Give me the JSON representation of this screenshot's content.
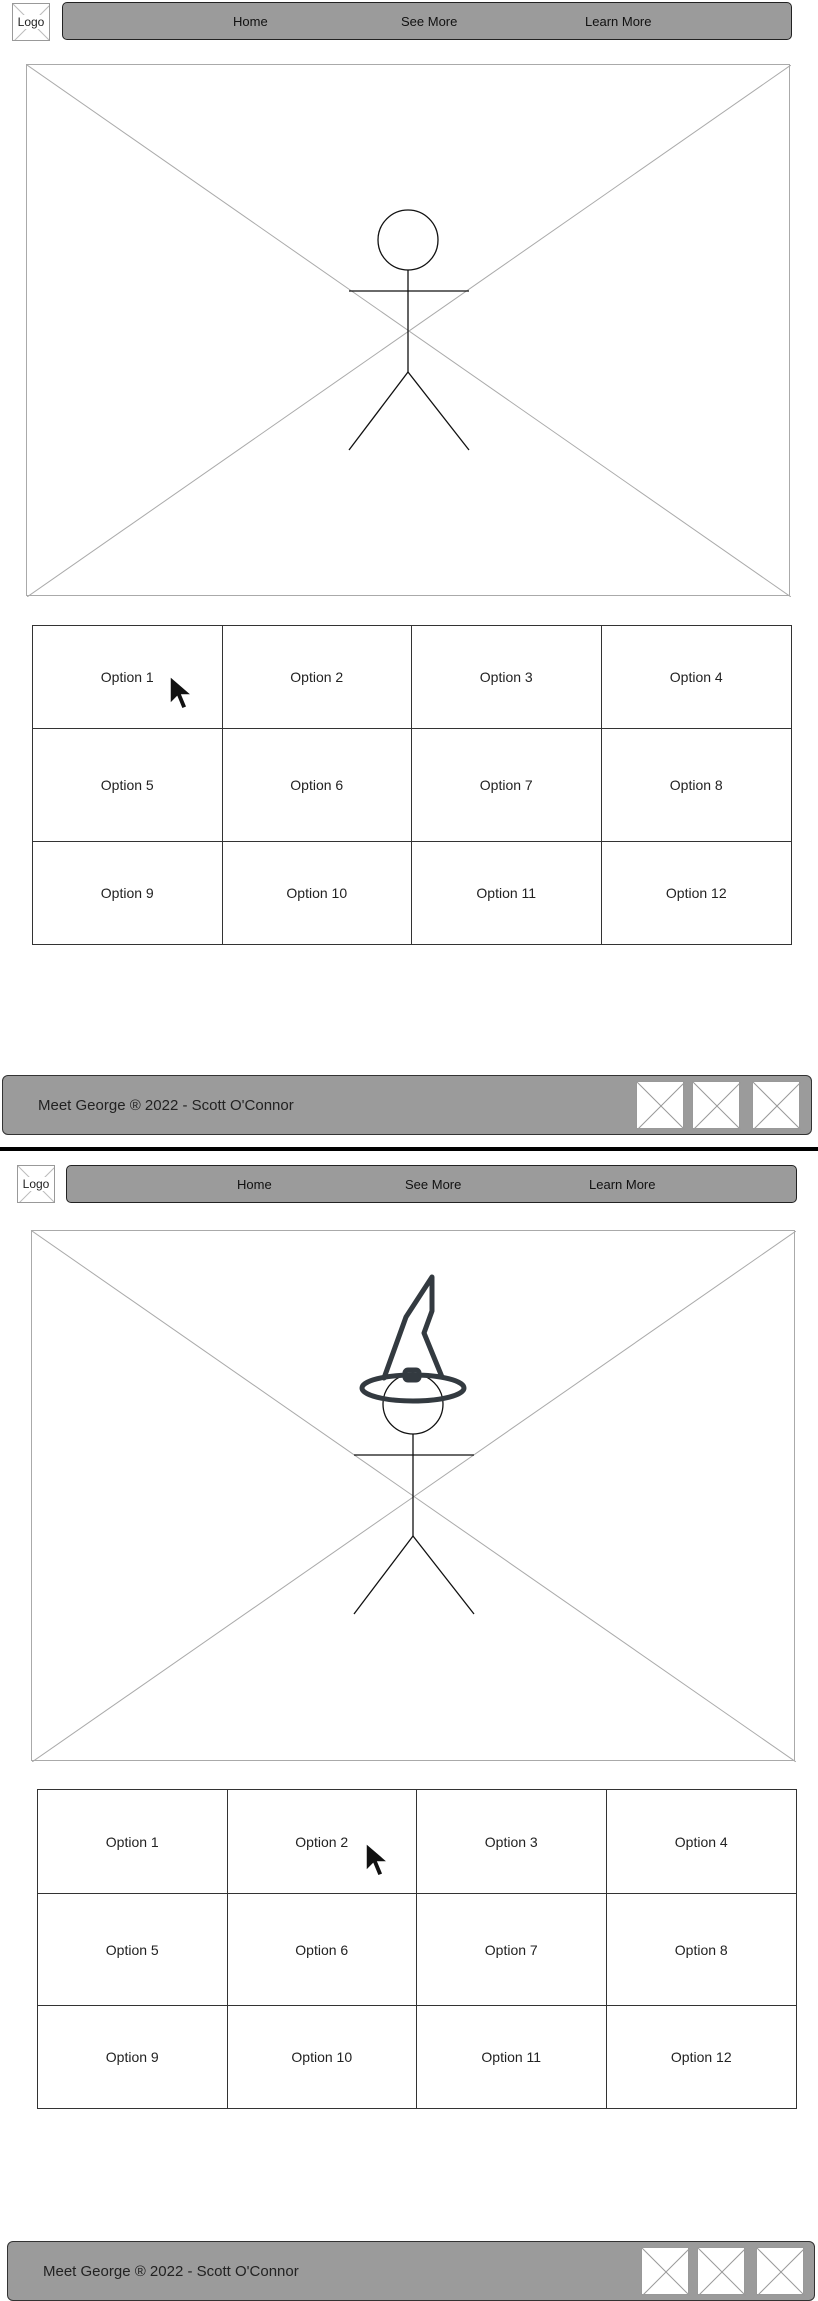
{
  "frames": [
    {
      "logo_label": "Logo",
      "nav": [
        "Home",
        "See More",
        "Learn More"
      ],
      "options": [
        "Option 1",
        "Option 2",
        "Option 3",
        "Option 4",
        "Option 5",
        "Option 6",
        "Option 7",
        "Option 8",
        "Option 9",
        "Option 10",
        "Option 11",
        "Option 12"
      ],
      "footer_text": "Meet George ® 2022 - Scott O'Connor",
      "hat": false
    },
    {
      "logo_label": "Logo",
      "nav": [
        "Home",
        "See More",
        "Learn More"
      ],
      "options": [
        "Option 1",
        "Option 2",
        "Option 3",
        "Option 4",
        "Option 5",
        "Option 6",
        "Option 7",
        "Option 8",
        "Option 9",
        "Option 10",
        "Option 11",
        "Option 12"
      ],
      "footer_text": "Meet George ® 2022 - Scott O'Connor",
      "hat": true
    }
  ],
  "icons": {
    "hero_figure": "stick-figure-icon",
    "hat": "witch-hat-icon",
    "cursor": "mouse-pointer-icon",
    "placeholder": "image-placeholder-icon"
  },
  "colors": {
    "bar": "#9b9b9b",
    "hat_stroke": "#333a40"
  }
}
